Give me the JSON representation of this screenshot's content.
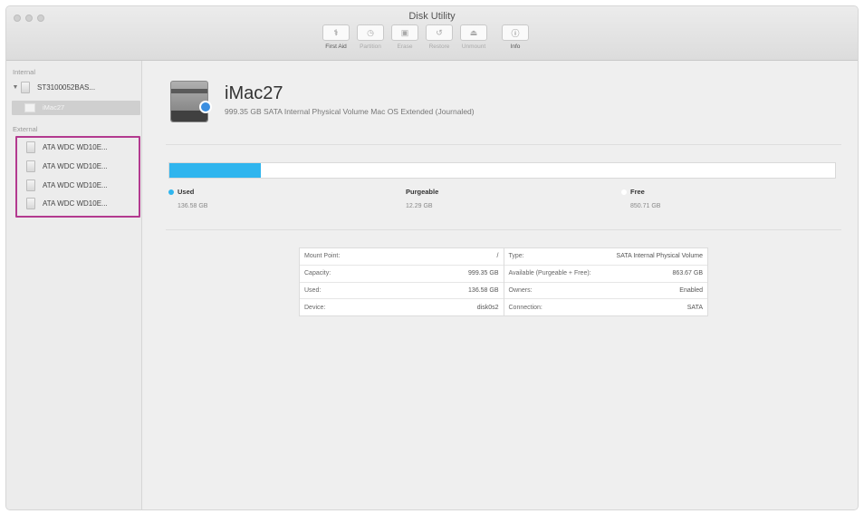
{
  "window": {
    "title": "Disk Utility"
  },
  "toolbar": {
    "items": [
      {
        "label": "First Aid",
        "glyph": "⚕",
        "active": true
      },
      {
        "label": "Partition",
        "glyph": "◷",
        "active": false
      },
      {
        "label": "Erase",
        "glyph": "▣",
        "active": false
      },
      {
        "label": "Restore",
        "glyph": "↺",
        "active": false
      },
      {
        "label": "Unmount",
        "glyph": "⏏",
        "active": false
      },
      {
        "label": "Info",
        "glyph": "ⓘ",
        "active": true
      }
    ]
  },
  "sidebar": {
    "internal_header": "Internal",
    "internal_disk": "ST3100052BAS...",
    "internal_volume": "iMac27",
    "external_header": "External",
    "external_disks": [
      "ATA WDC WD10E...",
      "ATA WDC WD10E...",
      "ATA WDC WD10E...",
      "ATA WDC WD10E..."
    ]
  },
  "volume": {
    "name": "iMac27",
    "subtitle": "999.35 GB SATA Internal Physical Volume Mac OS Extended (Journaled)"
  },
  "usage": {
    "used_fraction": 0.138,
    "used_label": "Used",
    "used_value": "136.58 GB",
    "purgeable_label": "Purgeable",
    "purgeable_value": "12.29 GB",
    "free_label": "Free",
    "free_value": "850.71 GB",
    "used_color": "#2fb5ee"
  },
  "info": {
    "left": [
      {
        "key": "Mount Point:",
        "value": "/"
      },
      {
        "key": "Capacity:",
        "value": "999.35 GB"
      },
      {
        "key": "Used:",
        "value": "136.58 GB"
      },
      {
        "key": "Device:",
        "value": "disk0s2"
      }
    ],
    "right": [
      {
        "key": "Type:",
        "value": "SATA Internal Physical Volume"
      },
      {
        "key": "Available (Purgeable + Free):",
        "value": "863.67 GB"
      },
      {
        "key": "Owners:",
        "value": "Enabled"
      },
      {
        "key": "Connection:",
        "value": "SATA"
      }
    ]
  }
}
